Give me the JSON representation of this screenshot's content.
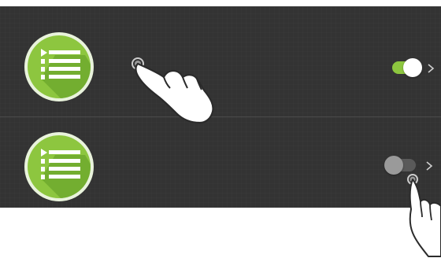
{
  "colors": {
    "panel_background": "#333333",
    "divider": "#4a4a4a",
    "icon_green": "#8dc63f",
    "icon_green_dark": "#5e9a25",
    "toggle_on_track": "#8dc63f",
    "toggle_off_track": "#5a5a5a",
    "toggle_off_knob": "#9a9a9a",
    "chevron": "#cfcfcf"
  },
  "list": {
    "items": [
      {
        "icon": "list-app-icon",
        "toggle_state": "on",
        "trailing_icon": "chevron-right-icon"
      },
      {
        "icon": "list-app-icon",
        "toggle_state": "off",
        "trailing_icon": "chevron-right-icon"
      }
    ]
  },
  "gestures": [
    {
      "icon": "hand-pointer-icon",
      "target": "list-item-1"
    },
    {
      "icon": "hand-pointer-icon",
      "target": "toggle-2"
    }
  ]
}
